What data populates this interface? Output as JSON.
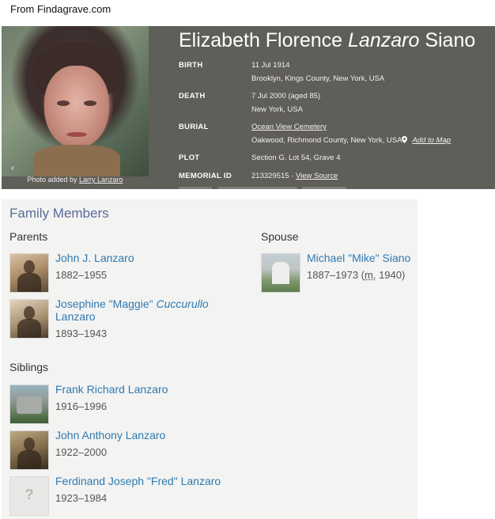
{
  "source": "From Findagrave.com",
  "memorial": {
    "name_first": "Elizabeth Florence ",
    "name_maiden": "Lanzaro",
    "name_last": " Siano",
    "photo_credit_prefix": "Photo added by ",
    "photo_credit_user": "Larry Lanzaro",
    "birth": {
      "label": "BIRTH",
      "date": "11 Jul 1914",
      "place": "Brooklyn, Kings County, New York, USA"
    },
    "death": {
      "label": "DEATH",
      "date": "7 Jul 2000 (aged 85)",
      "place": "New York, USA"
    },
    "burial": {
      "label": "BURIAL",
      "cemetery": "Ocean View Cemetery",
      "place": "Oakwood, Richmond County, New York, USA",
      "map_link": "Add to Map"
    },
    "plot": {
      "label": "PLOT",
      "value": "Section G. Lot 54, Grave 4"
    },
    "memorial_id": {
      "label": "MEMORIAL ID",
      "value": "213329515 · ",
      "link": "View Source"
    }
  },
  "family": {
    "title": "Family Members",
    "parents_heading": "Parents",
    "spouse_heading": "Spouse",
    "siblings_heading": "Siblings",
    "parents": [
      {
        "name": "John J. Lanzaro",
        "years": "1882–1955"
      },
      {
        "name_a": "Josephine \"Maggie\" ",
        "name_maiden": "Cuccurullo",
        "name_b": "Lanzaro",
        "years": "1893–1943"
      }
    ],
    "spouse": {
      "name": "Michael \"Mike\" Siano",
      "years": "1887–1973 (",
      "marr_abbr": "m.",
      "marr_year": " 1940)"
    },
    "siblings": [
      {
        "name": "Frank Richard Lanzaro",
        "years": "1916–1996"
      },
      {
        "name": "John Anthony Lanzaro",
        "years": "1922–2000"
      },
      {
        "name": "Ferdinand Joseph \"Fred\" Lanzaro",
        "years": "1923–1984"
      }
    ]
  }
}
